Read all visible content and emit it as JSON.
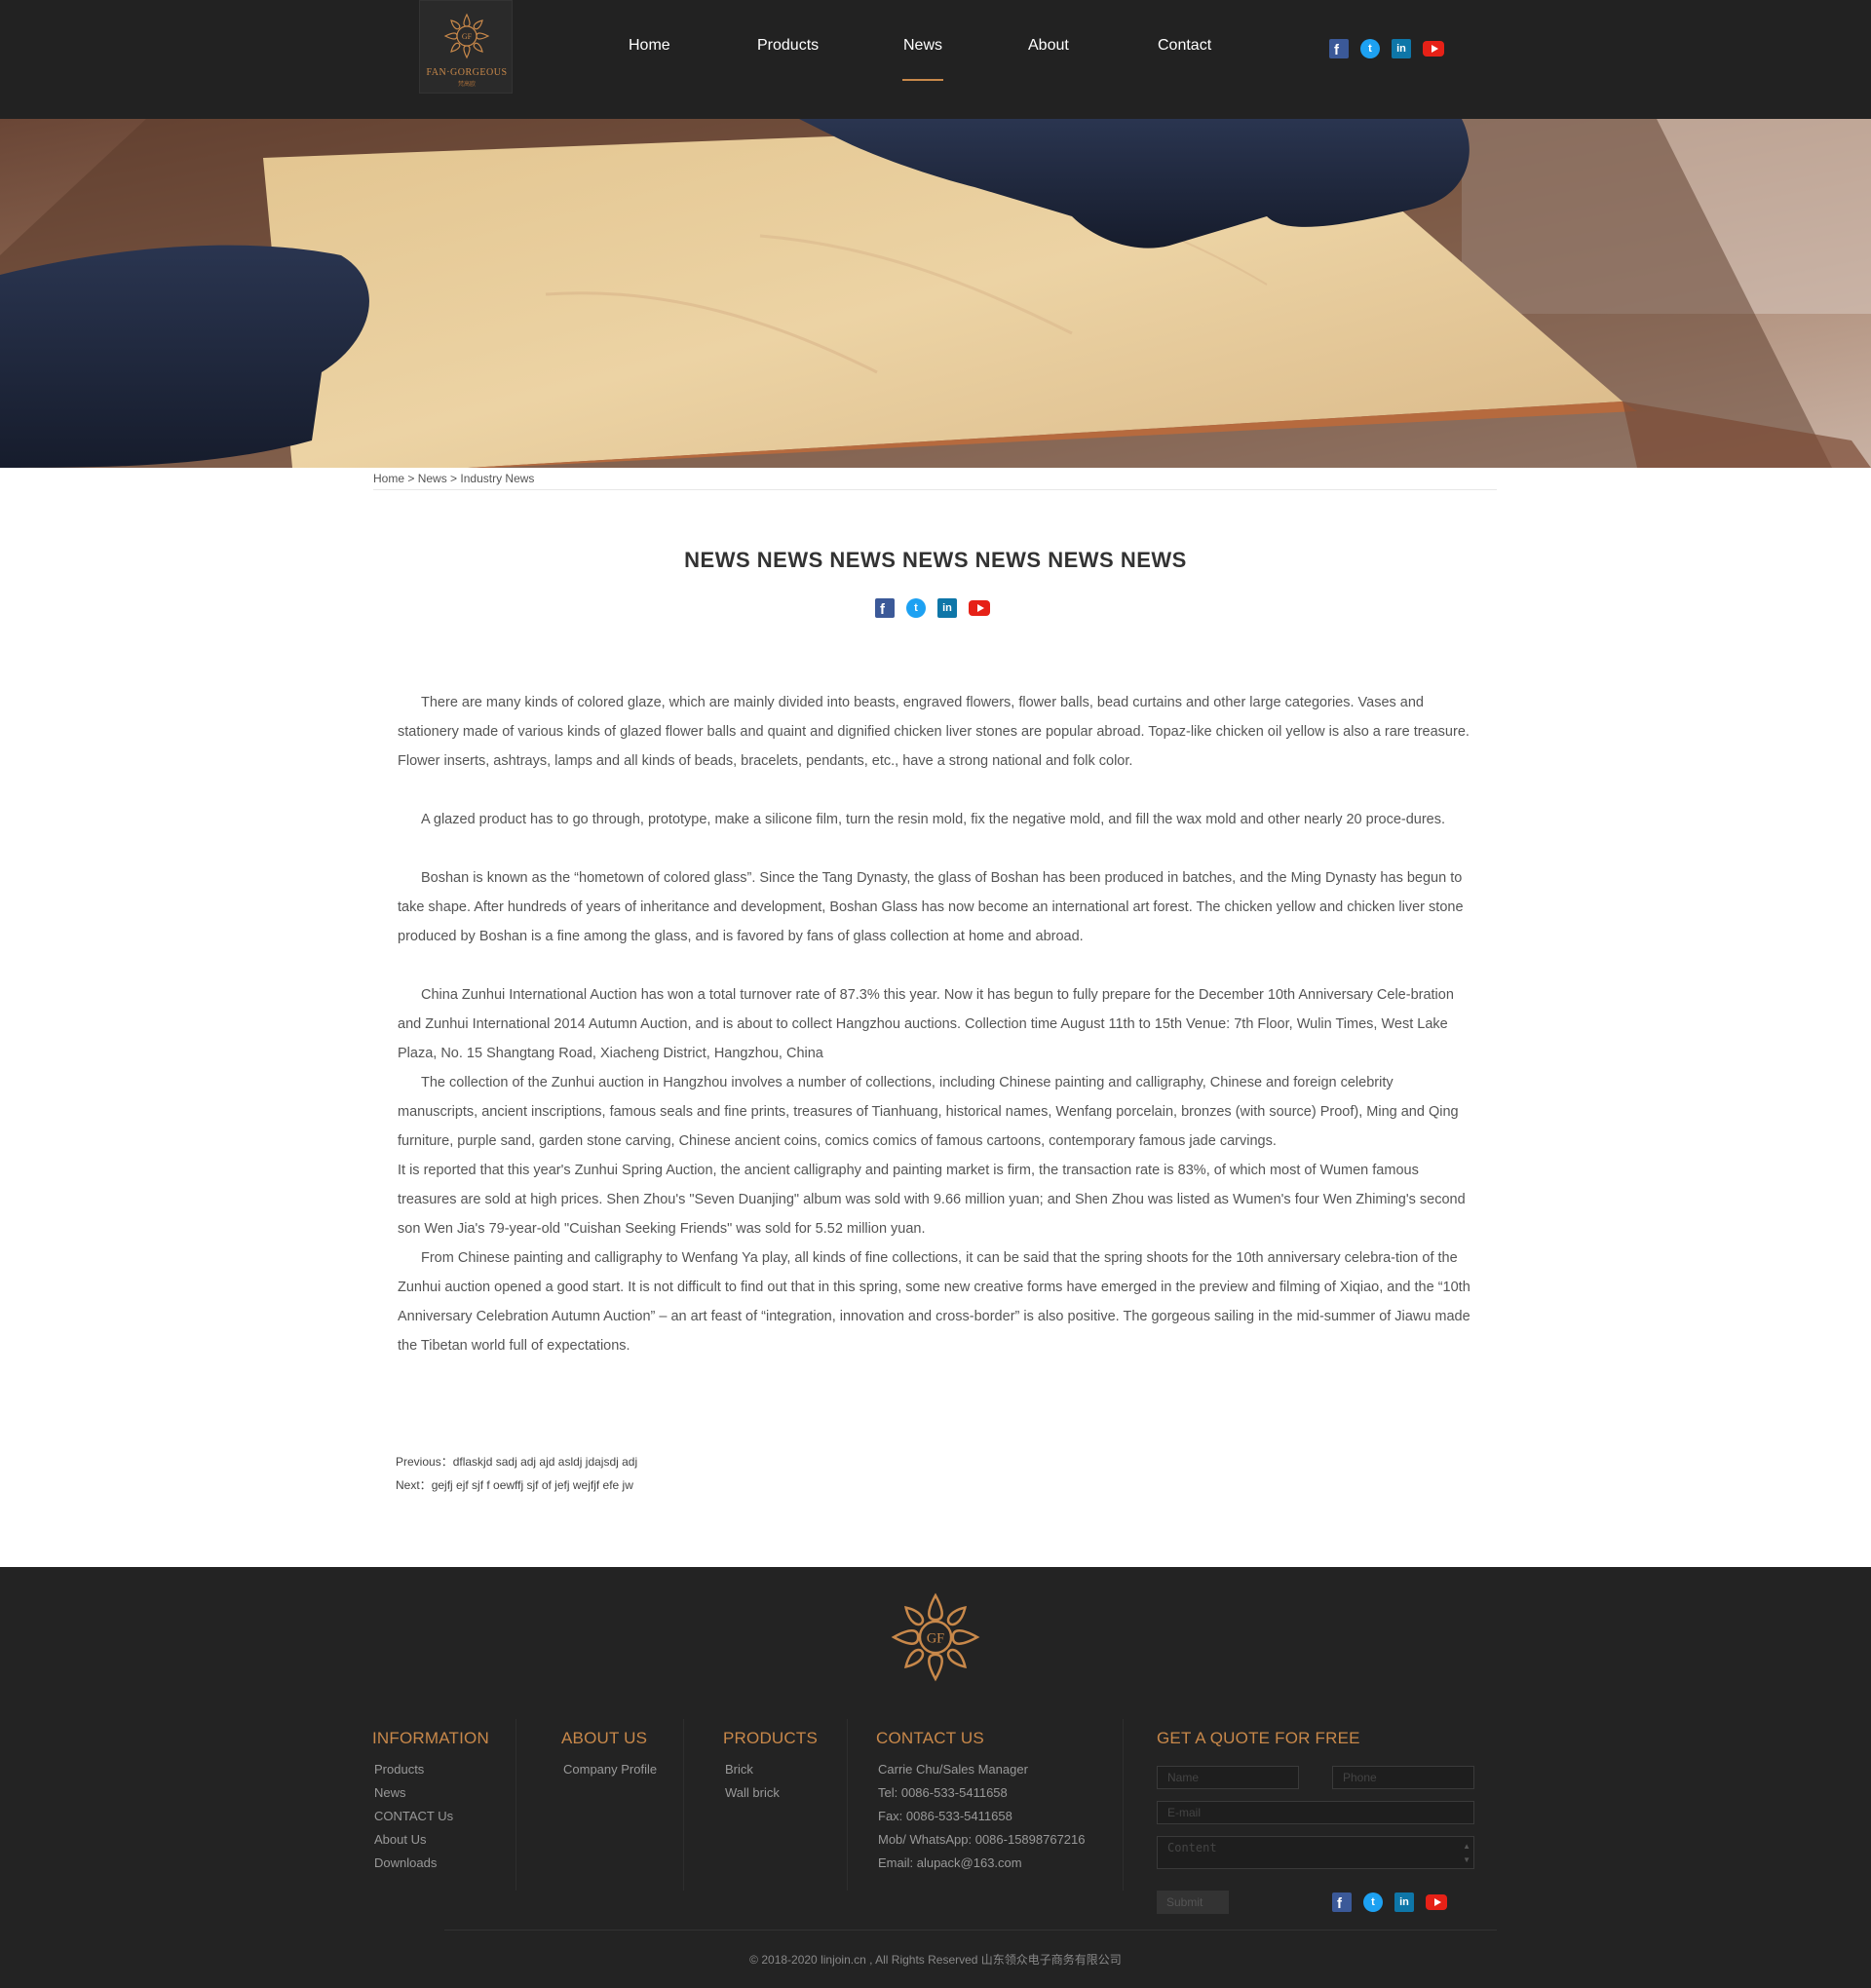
{
  "brand": {
    "name": "FAN·GORGEOUS",
    "sub": "梵高欧",
    "monogram": "GF",
    "accent_color": "#c8884a"
  },
  "nav": {
    "items": [
      {
        "label": "Home"
      },
      {
        "label": "Products"
      },
      {
        "label": "News"
      },
      {
        "label": "About"
      },
      {
        "label": "Contact"
      }
    ],
    "active": "News"
  },
  "social": {
    "facebook": "facebook-icon",
    "twitter": "twitter-icon",
    "linkedin": "linkedin-icon",
    "youtube": "youtube-icon"
  },
  "breadcrumb": {
    "home": "Home",
    "sep1": " > ",
    "news": "News",
    "sep2": " > ",
    "current": "Industry News"
  },
  "article": {
    "title": "NEWS NEWS NEWS NEWS NEWS NEWS NEWS",
    "paragraphs": [
      "There are many kinds of colored glaze, which are mainly divided into beasts, engraved flowers, flower balls, bead curtains and other large categories. Vases and stationery made of various kinds of glazed flower balls and quaint and dignified chicken liver stones are popular abroad. Topaz-like chicken oil yellow is also a rare treasure. Flower inserts, ashtrays, lamps and all kinds of beads, bracelets, pendants, etc., have a strong national and folk color.",
      "A glazed product has to go through, prototype, make a silicone film, turn the resin mold, fix the negative mold, and fill the wax mold and other nearly 20 proce-dures.",
      "Boshan is known as the “hometown of colored glass”. Since the Tang Dynasty, the glass of Boshan has been produced in batches, and the Ming Dynasty has begun to take shape. After hundreds of years of inheritance and development, Boshan Glass has now become an international art forest. The chicken yellow and chicken liver stone produced by Boshan is a fine among the glass, and is favored by fans of glass collection at home and abroad.",
      "China Zunhui International Auction has won a total turnover rate of 87.3% this year. Now it has begun to fully prepare for the December 10th Anniversary Cele-bration and Zunhui International 2014 Autumn Auction, and is about to collect Hangzhou auctions. Collection time August 11th to 15th Venue: 7th Floor, Wulin Times, West Lake Plaza, No. 15 Shangtang Road, Xiacheng District, Hangzhou, China",
      "The collection of the Zunhui auction in Hangzhou involves a number of collections, including Chinese painting and calligraphy, Chinese and foreign celebrity manuscripts, ancient inscriptions, famous seals and fine prints, treasures of Tianhuang, historical names, Wenfang porcelain, bronzes (with source) Proof), Ming and Qing furniture, purple sand, garden stone carving, Chinese ancient coins, comics comics of famous cartoons, contemporary famous jade carvings.",
      "It is reported that this year's Zunhui Spring Auction, the ancient calligraphy and painting market is firm, the transaction rate is 83%, of which most of Wumen famous treasures are sold at high prices. Shen Zhou's \"Seven Duanjing\" album was sold with 9.66 million yuan; and Shen Zhou was listed as Wumen's four Wen Zhiming's second son Wen Jia's 79-year-old \"Cuishan Seeking Friends\" was sold for 5.52 million yuan.",
      "From Chinese painting and calligraphy to Wenfang Ya play, all kinds of fine collections, it can be said that the spring shoots for the 10th anniversary celebra-tion of the Zunhui auction opened a good start. It is not difficult to find out that in this spring, some new creative forms have emerged in the preview and filming of Xiqiao, and the “10th Anniversary Celebration Autumn Auction” – an art feast of “integration, innovation and cross-border” is also positive. The gorgeous sailing in the mid-summer of Jiawu made the Tibetan world full of expectations."
    ],
    "previous_label": "Previous：",
    "previous_title": "dflaskjd sadj adj ajd asldj jdajsdj adj",
    "next_label": "Next：",
    "next_title": "gejfj ejf sjf f oewffj sjf of jefj wejfjf efe jw"
  },
  "footer": {
    "information": {
      "heading": "INFORMATION",
      "links": [
        "Products",
        "News",
        "CONTACT Us",
        "About Us",
        "Downloads"
      ]
    },
    "about": {
      "heading": "ABOUT US",
      "links": [
        "Company Profile"
      ]
    },
    "products": {
      "heading": "PRODUCTS",
      "links": [
        "Brick",
        "Wall brick"
      ]
    },
    "contact": {
      "heading": "CONTACT US",
      "lines": [
        "Carrie Chu/Sales Manager",
        "Tel: 0086-533-5411658",
        "Fax: 0086-533-5411658",
        "Mob/ WhatsApp: 0086-15898767216",
        "Email: alupack@163.com"
      ]
    },
    "quote": {
      "heading": "GET A QUOTE FOR FREE",
      "name_placeholder": "Name",
      "phone_placeholder": "Phone",
      "email_placeholder": "E-mail",
      "content_placeholder": "Content",
      "submit_label": "Submit"
    },
    "copyright": "© 2018-2020 linjoin.cn , All Rights Reserved 山东领众电子商务有限公司"
  }
}
